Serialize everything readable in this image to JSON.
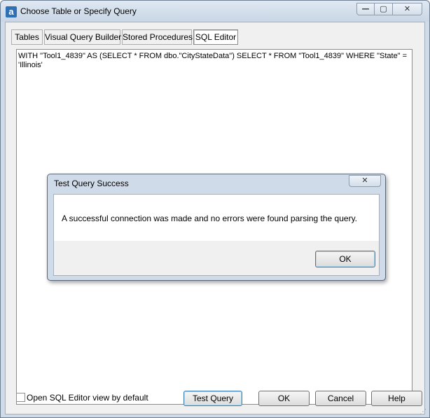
{
  "window": {
    "title": "Choose Table or Specify Query",
    "icon_glyph": "a",
    "controls": {
      "minimize": "—",
      "maximize": "▢",
      "close": "✕"
    }
  },
  "tabs": [
    {
      "label": "Tables",
      "active": false
    },
    {
      "label": "Visual Query Builder",
      "active": false
    },
    {
      "label": "Stored Procedures",
      "active": false
    },
    {
      "label": "SQL Editor",
      "active": true
    }
  ],
  "editor": {
    "sql": "WITH \"Tool1_4839\" AS (SELECT * FROM dbo.\"CityStateData\") SELECT * FROM \"Tool1_4839\" WHERE \"State\" = 'Illinois'"
  },
  "footer": {
    "checkbox_label": "Open SQL Editor view by default",
    "checkbox_checked": false,
    "test_query_label": "Test Query",
    "ok_label": "OK",
    "cancel_label": "Cancel",
    "help_label": "Help"
  },
  "dialog": {
    "title": "Test Query Success",
    "close_glyph": "✕",
    "message": "A successful connection was made and no errors were found parsing the query.",
    "ok_label": "OK"
  }
}
